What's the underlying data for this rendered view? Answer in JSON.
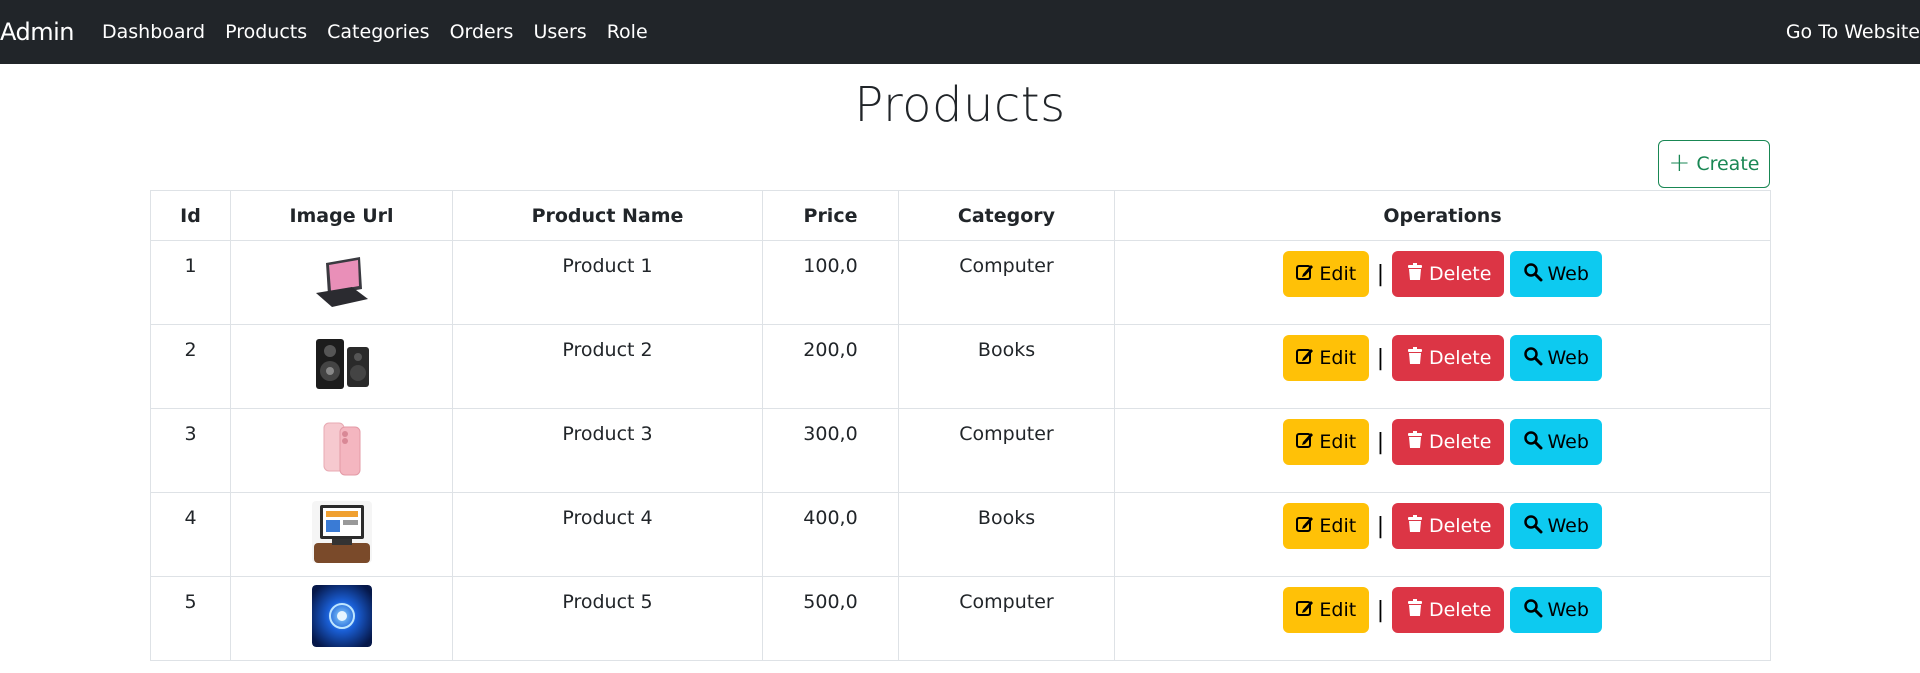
{
  "navbar": {
    "brand": "Admin",
    "links": [
      "Dashboard",
      "Products",
      "Categories",
      "Orders",
      "Users",
      "Role"
    ],
    "right_link": "Go To Website"
  },
  "page": {
    "title": "Products",
    "create_label": "Create"
  },
  "table": {
    "headers": [
      "Id",
      "Image Url",
      "Product Name",
      "Price",
      "Category",
      "Operations"
    ],
    "rows": [
      {
        "id": "1",
        "image": "laptop-image",
        "name": "Product 1",
        "price": "100,0",
        "category": "Computer"
      },
      {
        "id": "2",
        "image": "speakers-image",
        "name": "Product 2",
        "price": "200,0",
        "category": "Books"
      },
      {
        "id": "3",
        "image": "phone-image",
        "name": "Product 3",
        "price": "300,0",
        "category": "Computer"
      },
      {
        "id": "4",
        "image": "monitor-image",
        "name": "Product 4",
        "price": "400,0",
        "category": "Books"
      },
      {
        "id": "5",
        "image": "blue-abstract-image",
        "name": "Product 5",
        "price": "500,0",
        "category": "Computer"
      }
    ],
    "operations": {
      "edit_label": "Edit",
      "separator": "|",
      "delete_label": "Delete",
      "web_label": "Web"
    }
  },
  "colors": {
    "navbar_bg": "#212529",
    "create_border": "#198754",
    "edit": "#ffc107",
    "delete": "#dc3545",
    "web": "#0dcaf0"
  },
  "icons": {
    "create": "plus-icon",
    "edit": "edit-icon",
    "delete": "trash-icon",
    "web": "search-icon"
  }
}
